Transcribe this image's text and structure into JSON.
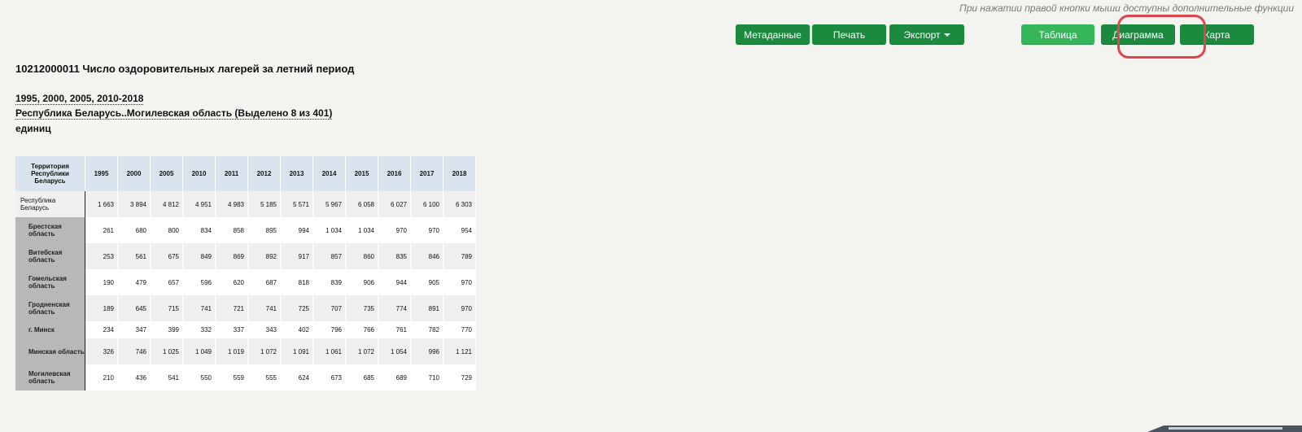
{
  "hint": "При нажатии правой кнопки мыши доступны дополнительные функции",
  "toolbar": {
    "metadata": "Метаданные",
    "print": "Печать",
    "export": "Экспорт",
    "table": "Таблица",
    "diagram": "Диаграмма",
    "map": "Карта"
  },
  "title": "10212000011 Число оздоровительных лагерей за летний период",
  "period": "1995, 2000, 2005, 2010-2018",
  "territory": "Республика Беларусь..Могилевская область (Выделено 8 из 401)",
  "unit": "единиц",
  "table": {
    "corner": "Территория Республики Беларусь",
    "years": [
      "1995",
      "2000",
      "2005",
      "2010",
      "2011",
      "2012",
      "2013",
      "2014",
      "2015",
      "2016",
      "2017",
      "2018"
    ],
    "rows": [
      {
        "name": "Республика Беларусь",
        "values": [
          "1 663",
          "3 894",
          "4 812",
          "4 951",
          "4 983",
          "5 185",
          "5 571",
          "5 967",
          "6 058",
          "6 027",
          "6 100",
          "6 303"
        ]
      },
      {
        "name": "Брестская область",
        "values": [
          "261",
          "680",
          "800",
          "834",
          "858",
          "895",
          "994",
          "1 034",
          "1 034",
          "970",
          "970",
          "954"
        ]
      },
      {
        "name": "Витебская область",
        "values": [
          "253",
          "561",
          "675",
          "849",
          "869",
          "892",
          "917",
          "857",
          "860",
          "835",
          "846",
          "789"
        ]
      },
      {
        "name": "Гомельская область",
        "values": [
          "190",
          "479",
          "657",
          "596",
          "620",
          "687",
          "818",
          "839",
          "906",
          "944",
          "905",
          "970"
        ]
      },
      {
        "name": "Гродненская область",
        "values": [
          "189",
          "645",
          "715",
          "741",
          "721",
          "741",
          "725",
          "707",
          "735",
          "774",
          "891",
          "970"
        ]
      },
      {
        "name": "г. Минск",
        "values": [
          "234",
          "347",
          "399",
          "332",
          "337",
          "343",
          "402",
          "796",
          "766",
          "761",
          "782",
          "770"
        ]
      },
      {
        "name": "Минская область",
        "values": [
          "326",
          "746",
          "1 025",
          "1 049",
          "1 019",
          "1 072",
          "1 091",
          "1 061",
          "1 072",
          "1 054",
          "996",
          "1 121"
        ]
      },
      {
        "name": "Могилевская область",
        "values": [
          "210",
          "436",
          "541",
          "550",
          "559",
          "555",
          "624",
          "673",
          "685",
          "689",
          "710",
          "729"
        ]
      }
    ]
  }
}
